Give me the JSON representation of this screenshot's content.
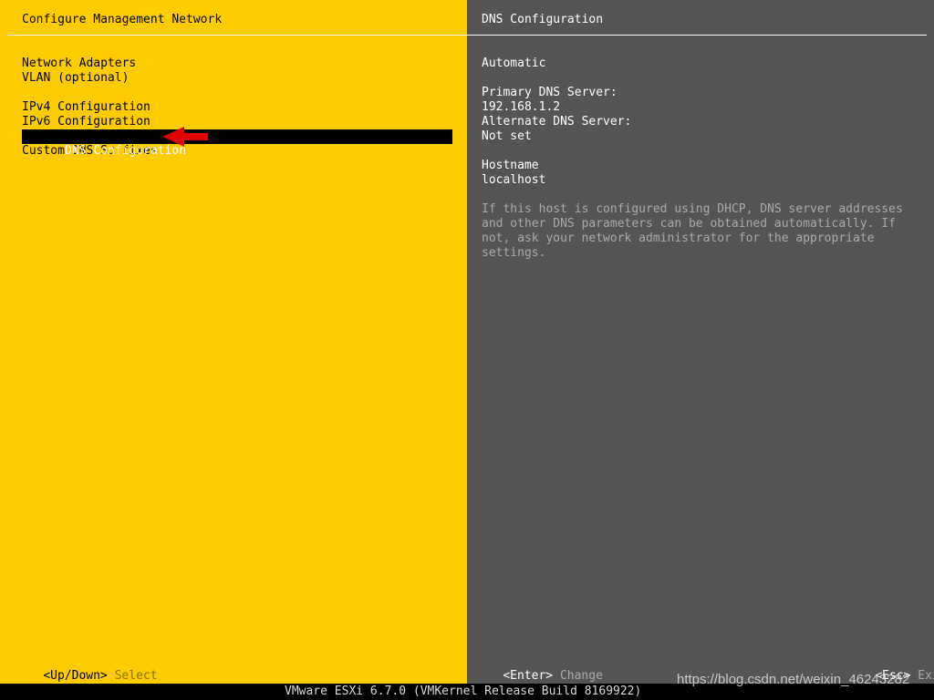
{
  "left_panel": {
    "title": "Configure Management Network",
    "menu": [
      {
        "label": "Network Adapters"
      },
      {
        "label": "VLAN (optional)"
      },
      {
        "label": ""
      },
      {
        "label": "IPv4 Configuration"
      },
      {
        "label": "IPv6 Configuration"
      },
      {
        "label": "DNS Configuration"
      },
      {
        "label": "Custom DNS Suffixes"
      }
    ],
    "footer": {
      "key": "<Up/Down>",
      "action": "Select"
    }
  },
  "right_panel": {
    "title": "DNS Configuration",
    "mode": "Automatic",
    "primary_dns_label": "Primary DNS Server:",
    "primary_dns_value": "192.168.1.2",
    "alternate_dns_label": "Alternate DNS Server:",
    "alternate_dns_value": "Not set",
    "hostname_label": "Hostname",
    "hostname_value": "localhost",
    "help_text": "If this host is configured using DHCP, DNS server addresses\nand other DNS parameters can be obtained automatically. If\nnot, ask your network administrator for the appropriate\nsettings.",
    "footer_enter": {
      "key": "<Enter>",
      "action": "Change"
    },
    "footer_esc": {
      "key": "<Esc>",
      "action": "Exit"
    }
  },
  "status_bar": "VMware ESXi 6.7.0 (VMKernel Release Build 8169922)",
  "watermark": "https://blog.csdn.net/weixin_46243282",
  "colors": {
    "left_bg": "#ffcc00",
    "right_bg": "#555555",
    "selection": "#000000",
    "arrow": "#e00000"
  }
}
